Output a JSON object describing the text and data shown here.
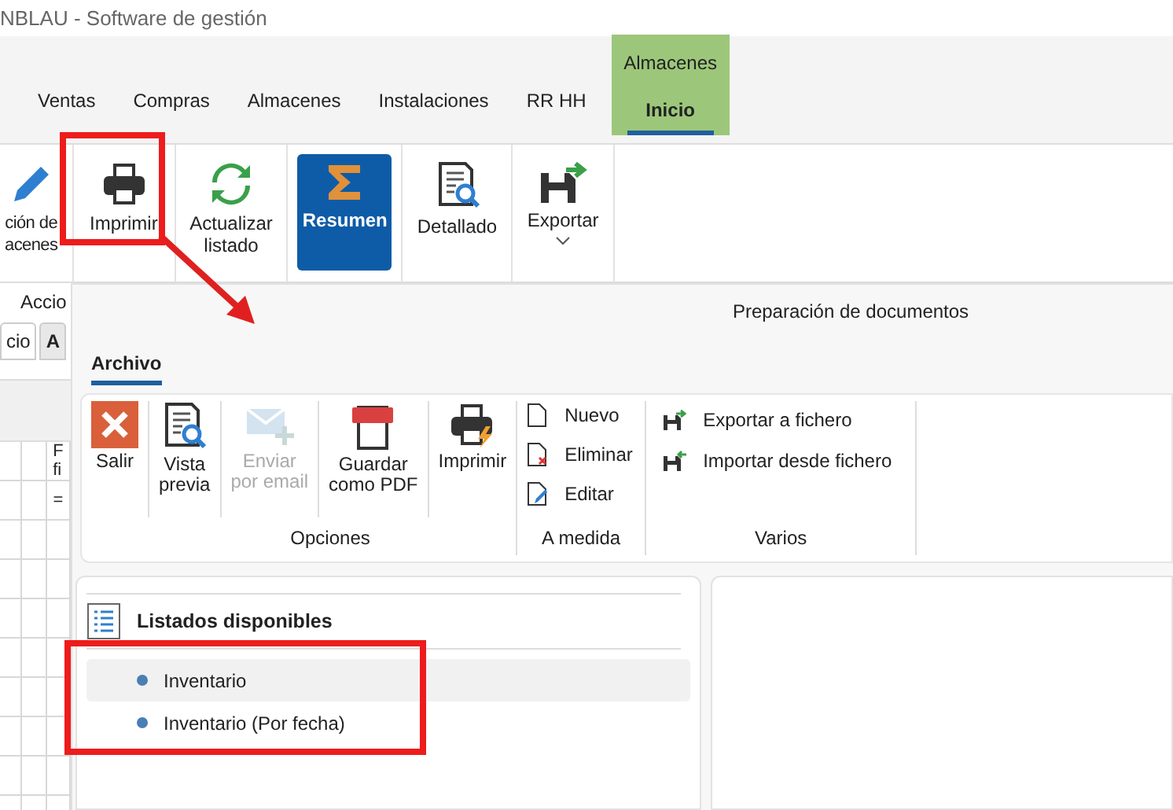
{
  "window": {
    "title": "NBLAU - Software de gestión"
  },
  "ribbon_tabs": [
    {
      "label": "Ventas",
      "selected": false
    },
    {
      "label": "Compras",
      "selected": false
    },
    {
      "label": "Almacenes",
      "selected": false
    },
    {
      "label": "Instalaciones",
      "selected": false
    },
    {
      "label": "RR HH",
      "selected": false
    },
    {
      "label": "Inicio",
      "selected": true,
      "context": "Almacenes"
    }
  ],
  "ribbon_buttons": [
    {
      "label": "ción de\nacenes",
      "selected": false
    },
    {
      "label": "Imprimir",
      "selected": false
    },
    {
      "label": "Actualizar\nlistado",
      "selected": false
    },
    {
      "label": "Resumen",
      "selected": true
    },
    {
      "label": "Detallado",
      "selected": false
    },
    {
      "label": "Exportar",
      "selected": false,
      "dropdown": true
    }
  ],
  "ribbon_group": "Accio",
  "side_tabs": [
    {
      "label": "cio",
      "selected": true
    },
    {
      "label": "A",
      "selected": false
    }
  ],
  "grid": {
    "header": "F\nfi",
    "filter": "="
  },
  "dialog": {
    "title": "Preparación de documentos",
    "tabs": [
      {
        "label": "Archivo",
        "selected": true
      }
    ],
    "options": {
      "label": "Opciones",
      "buttons": [
        {
          "label": "Salir",
          "disabled": false
        },
        {
          "label": "Vista\nprevia",
          "disabled": false
        },
        {
          "label": "Enviar\npor email",
          "disabled": true
        },
        {
          "label": "Guardar\ncomo PDF",
          "disabled": false
        },
        {
          "label": "Imprimir",
          "disabled": false
        }
      ]
    },
    "custom": {
      "label": "A medida",
      "items": [
        "Nuevo",
        "Eliminar",
        "Editar"
      ]
    },
    "misc": {
      "label": "Varios",
      "items": [
        "Exportar a fichero",
        "Importar desde fichero"
      ]
    },
    "listados": {
      "title": "Listados disponibles",
      "items": [
        {
          "label": "Inventario",
          "selected": true
        },
        {
          "label": "Inventario (Por fecha)",
          "selected": false
        }
      ]
    }
  }
}
